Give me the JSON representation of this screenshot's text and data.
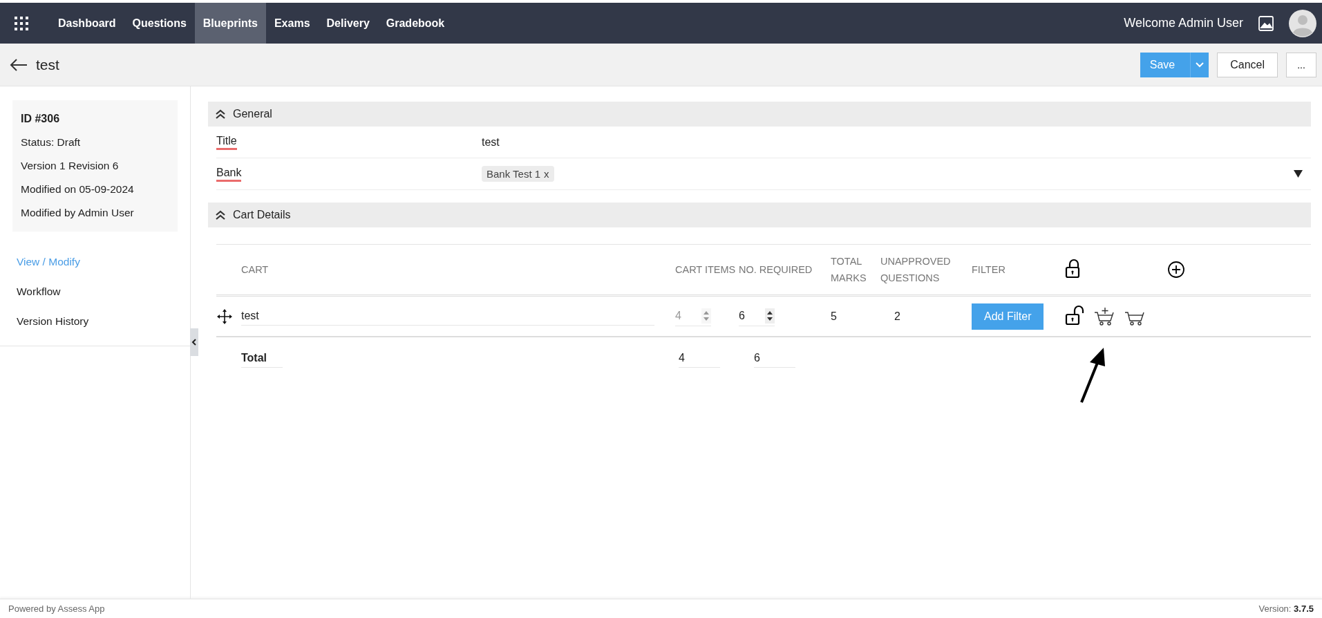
{
  "nav": {
    "items": [
      {
        "label": "Dashboard",
        "selected": false
      },
      {
        "label": "Questions",
        "selected": false
      },
      {
        "label": "Blueprints",
        "selected": true
      },
      {
        "label": "Exams",
        "selected": false
      },
      {
        "label": "Delivery",
        "selected": false
      },
      {
        "label": "Gradebook",
        "selected": false
      }
    ],
    "welcome": "Welcome Admin User"
  },
  "header": {
    "title": "test",
    "save": "Save",
    "cancel": "Cancel",
    "more": "..."
  },
  "info": {
    "id": "ID #306",
    "lines": [
      "Status: Draft",
      "Version 1 Revision 6",
      "Modified on 05-09-2024",
      "Modified by Admin User"
    ]
  },
  "sidebar_links": [
    {
      "label": "View / Modify",
      "selected": true
    },
    {
      "label": "Workflow",
      "selected": false
    },
    {
      "label": "Version History",
      "selected": false
    }
  ],
  "general": {
    "heading": "General",
    "expanded": true,
    "title_label": "Title",
    "title_value": "test",
    "bank_label": "Bank",
    "bank_tags": [
      {
        "label": "Bank Test 1",
        "remove": "x"
      }
    ]
  },
  "cart_details": {
    "heading": "Cart Details",
    "expanded": true,
    "columns": [
      "CART",
      "CART ITEMS",
      "NO. REQUIRED",
      "TOTAL MARKS",
      "UNAPPROVED QUESTIONS",
      "FILTER"
    ],
    "header_locked": true,
    "rows": [
      {
        "name": "test",
        "cart_items": "4",
        "cart_items_disabled": true,
        "no_required": "6",
        "total_marks": "5",
        "unapproved": "2",
        "filter_button": "Add Filter",
        "locked": false
      }
    ],
    "total": {
      "label": "Total",
      "cart_items": "4",
      "no_required": "6"
    }
  },
  "footer": {
    "text": "Powered by Assess App",
    "version": "Version: **3.7.5**"
  }
}
